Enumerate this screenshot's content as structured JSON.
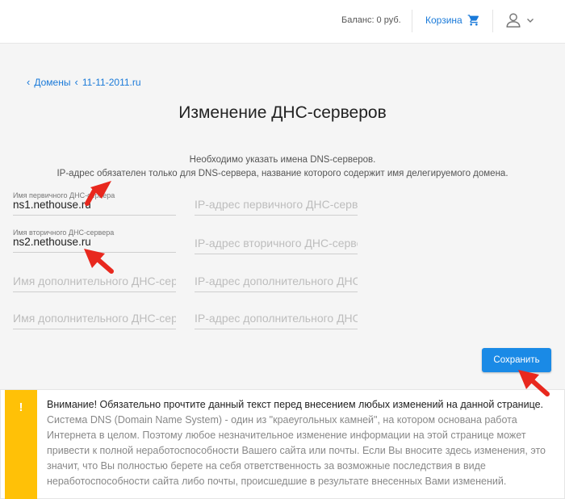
{
  "header": {
    "balance": "Баланс: 0 руб.",
    "cart_label": "Корзина",
    "cart_icon": "cart-icon",
    "user_icon": "user-icon",
    "accent_color": "#1a7ad9"
  },
  "breadcrumb": {
    "items": [
      "Домены",
      "11-11-2011.ru"
    ]
  },
  "page_title": "Изменение ДНС-серверов",
  "info": {
    "line1": "Необходимо указать имена DNS-серверов.",
    "line2": "IP-адрес обязателен только для DNS-сервера, название которого содержит имя делегируемого домена."
  },
  "form": {
    "primary": {
      "label": "Имя первичного ДНС-сервера",
      "value": "ns1.nethouse.ru",
      "ip_placeholder": "IP-адрес первичного ДНС-сервера"
    },
    "secondary": {
      "label": "Имя вторичного ДНС-сервера",
      "value": "ns2.nethouse.ru",
      "ip_placeholder": "IP-адрес вторичного ДНС-сервера"
    },
    "extra1": {
      "name_placeholder": "Имя дополнительного ДНС-сервера",
      "ip_placeholder": "IP-адрес дополнительного ДНС-сервера"
    },
    "extra2": {
      "name_placeholder": "Имя дополнительного ДНС-сервера",
      "ip_placeholder": "IP-адрес дополнительного ДНС-сервера"
    },
    "save_label": "Сохранить"
  },
  "warning": {
    "icon": "!",
    "title": "Внимание! Обязательно прочтите данный текст перед внесением любых изменений на данной странице.",
    "body": "Система DNS (Domain Name System) - один из \"краеугольных камней\", на котором основана работа Интернета в целом. Поэтому любое незначительное изменение информации на этой странице может привести к полной неработоспособности Вашего сайта или почты. Если Вы вносите здесь изменения, это значит, что Вы полностью берете на себя ответственность за возможные последствия в виде неработоспособности сайта либо почты, происшедшие в результате внесенных Вами изменений.",
    "color": "#ffc107"
  }
}
